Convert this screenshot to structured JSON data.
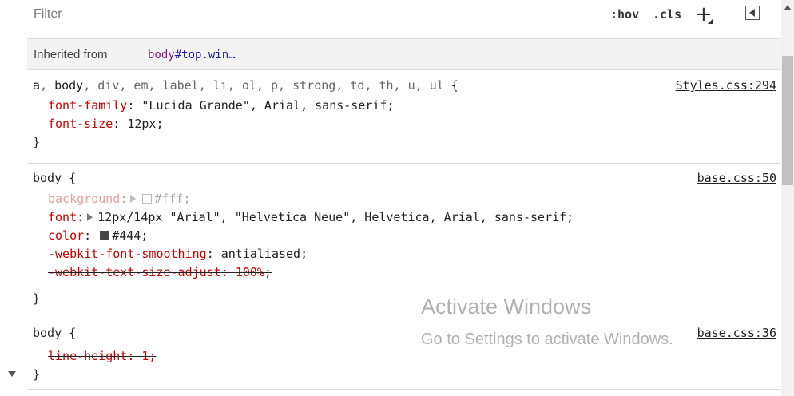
{
  "filter": {
    "placeholder": "Filter"
  },
  "toolbar": {
    "hov": ":hov",
    "cls": ".cls",
    "plus": "+"
  },
  "inherited": {
    "label": "Inherited from",
    "tag": "body",
    "id": "#top",
    "cls": ".win…"
  },
  "rules": [
    {
      "selector_parts": [
        {
          "text": "a",
          "dim": false
        },
        {
          "text": ", ",
          "dim": true
        },
        {
          "text": "body",
          "dim": false
        },
        {
          "text": ", div, em, label, li, ol, p, strong, td, th, u, ul",
          "dim": true
        }
      ],
      "brace_open": " {",
      "source": "Styles.css:294",
      "declarations": [
        {
          "name": "font-family",
          "value": "\"Lucida Grande\", Arial, sans-serif;"
        },
        {
          "name": "font-size",
          "value": "12px;"
        }
      ],
      "brace_close": "}"
    },
    {
      "selector": "body",
      "brace_open": " {",
      "source": "base.css:50",
      "declarations": [
        {
          "name": "background",
          "value": "#fff;",
          "swatch": "#ffffff",
          "inactive": true
        },
        {
          "name": "font",
          "value": "12px/14px \"Arial\", \"Helvetica Neue\", Helvetica, Arial, sans-serif;"
        },
        {
          "name": "color",
          "value": "#444;",
          "swatch": "#444444"
        },
        {
          "name": "-webkit-font-smoothing",
          "value": "antialiased;"
        },
        {
          "name": "-webkit-text-size-adjust",
          "value": "100%;",
          "overridden": true
        }
      ],
      "brace_close": "}"
    },
    {
      "selector": "body",
      "brace_open": " {",
      "source": "base.css:36",
      "declarations": [
        {
          "name": "line-height",
          "value": "1;",
          "overridden": true
        }
      ],
      "brace_close": "}"
    }
  ],
  "watermark": {
    "title": "Activate Windows",
    "subtitle": "Go to Settings to activate Windows."
  }
}
